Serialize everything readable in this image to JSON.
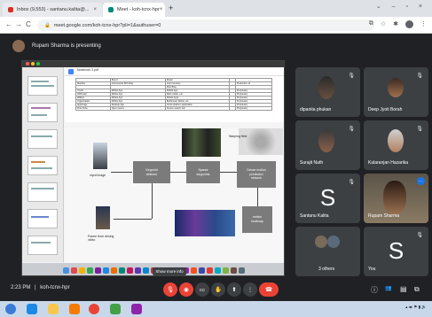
{
  "browser": {
    "tabs": [
      {
        "label": "Inbox (9,553) - santanu.kalita@...",
        "close": "×",
        "favicon_color": "#d93025"
      },
      {
        "label": "Meet - koh-tcnx-hpr",
        "close": "×",
        "favicon_color": "#00897b"
      }
    ],
    "new_tab": "+",
    "window_controls": "⌄ – ▫ ×",
    "url": "meet.google.com/koh-tcnx-hpr?pli=1&authuser=0",
    "nav": {
      "back": "←",
      "forward": "→",
      "reload": "C"
    }
  },
  "meet": {
    "presenting_text": "Rupam Sharma is presenting",
    "time": "2:23 PM",
    "separator": "|",
    "meeting_code": "koh-tcnx-hpr",
    "tooltip": "Show more info",
    "participants": [
      {
        "name": "dipanita phukan",
        "letter": ""
      },
      {
        "name": "Deep Jyoti Borah",
        "letter": ""
      },
      {
        "name": "Surajit Nath",
        "letter": ""
      },
      {
        "name": "Kularanjan Hazarika",
        "letter": ""
      },
      {
        "name": "Santanu Kalita",
        "letter": "S"
      },
      {
        "name": "Rupam Sharma",
        "letter": ""
      },
      {
        "name": "3 others",
        "letter": ""
      },
      {
        "name": "You",
        "letter": "S"
      }
    ],
    "mic_icon": "🎙",
    "more_icon": "⋯",
    "controls": {
      "mic": "🎙",
      "camera": "◉",
      "captions": "CC",
      "hand": "✋",
      "present": "⬆",
      "more": "⋮",
      "end": "☎"
    },
    "right_icons": {
      "info": "ⓘ",
      "people": "👥",
      "chat": "▤",
      "activities": "⧉"
    }
  },
  "shared_screen": {
    "doc_title": "Notebook 3.pdf",
    "table_rows": [
      [
        "",
        "Brand",
        "Model",
        "",
        ""
      ],
      [
        "Machine",
        "Commercial 3DX Daly",
        "Intel Inventory",
        "",
        "Production 11"
      ],
      [
        "",
        "",
        "Web Blog",
        "",
        ""
      ],
      [
        "Credit",
        "Mobile App",
        "Mobile App",
        "",
        "Proprietary"
      ],
      [
        "AWS (all)",
        "Mobile App",
        "Web mobile, etc",
        "",
        "Proprietary"
      ],
      [
        "Walltec",
        "Mobile App",
        "Mobile Apps",
        "",
        "Proprietary"
      ],
      [
        "Organization",
        "Mobile App",
        "Buildmosel Webst, etc",
        "",
        "Proprietary"
      ],
      [
        "AppImage",
        "Desktop App",
        "Cross-platform application",
        "",
        "Proprietary"
      ],
      [
        "Flow Kube",
        "Open source",
        "Source search tool",
        "",
        "Proprietary"
      ]
    ],
    "diagram": {
      "input_image": "input image",
      "frame_label": "Frame from driving\nvideo",
      "keypoint_detector": "Keypoint\ndetector",
      "sparse_keypoints": "Sparse\nkeypoints",
      "dense_motion": "Dense motion\nprediction\nnetwork",
      "motion_heatmap": "motion\nheatmap",
      "warping": "Warping field"
    }
  },
  "colors": {
    "meet_bg": "#202124",
    "tile_bg": "#3c4043",
    "end_call": "#ea4335",
    "accent_blue": "#1a73e8"
  }
}
